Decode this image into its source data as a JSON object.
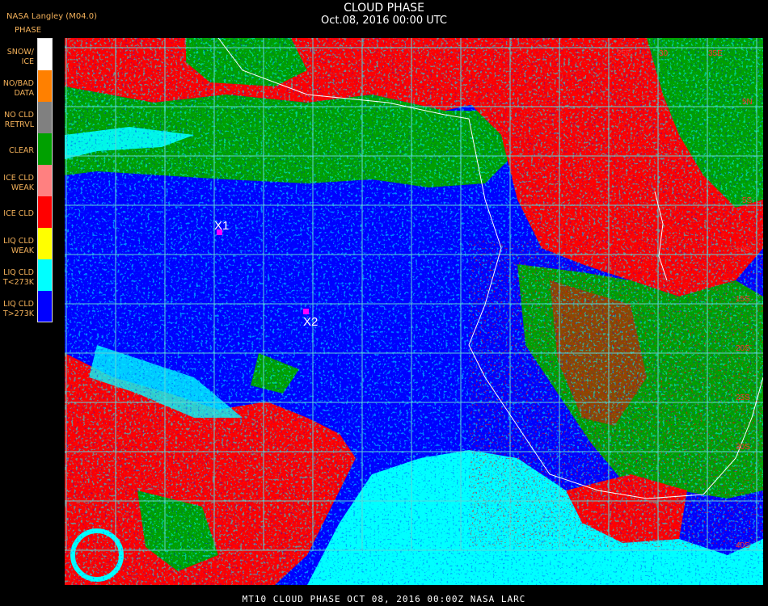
{
  "header": {
    "title": "CLOUD PHASE",
    "datetime": "Oct.08, 2016 00:00 UTC"
  },
  "source": "NASA Langley (M04.0)",
  "legend": {
    "title": "PHASE",
    "items": [
      {
        "label": "SNOW/\nICE",
        "color": "#ffffff"
      },
      {
        "label": "NO/BAD\nDATA",
        "color": "#ff8000"
      },
      {
        "label": "NO CLD\nRETRVL",
        "color": "#808080"
      },
      {
        "label": "CLEAR",
        "color": "#00a000"
      },
      {
        "label": "ICE CLD\nWEAK",
        "color": "#ff8080"
      },
      {
        "label": "ICE CLD",
        "color": "#ff0000"
      },
      {
        "label": "LIQ CLD\nWEAK",
        "color": "#ffff00"
      },
      {
        "label": "LIQ CLD\nT<273K",
        "color": "#00ffff"
      },
      {
        "label": "LIQ CLD\nT>273K",
        "color": "#0000ff"
      }
    ]
  },
  "map": {
    "markers": [
      {
        "label": "X1"
      },
      {
        "label": "X2"
      }
    ],
    "lon_labels": [
      "25E",
      "30",
      "35E"
    ],
    "lat_labels": [
      "5N",
      "5S",
      "10S",
      "15S",
      "20S",
      "25S",
      "30S",
      "40S"
    ],
    "colors": {
      "grid": "#5fd4d4",
      "coast": "#ffffff",
      "marker": "#ff00ff"
    }
  },
  "footer": "MT10  CLOUD PHASE   OCT 08, 2016 00:00Z   NASA LARC"
}
